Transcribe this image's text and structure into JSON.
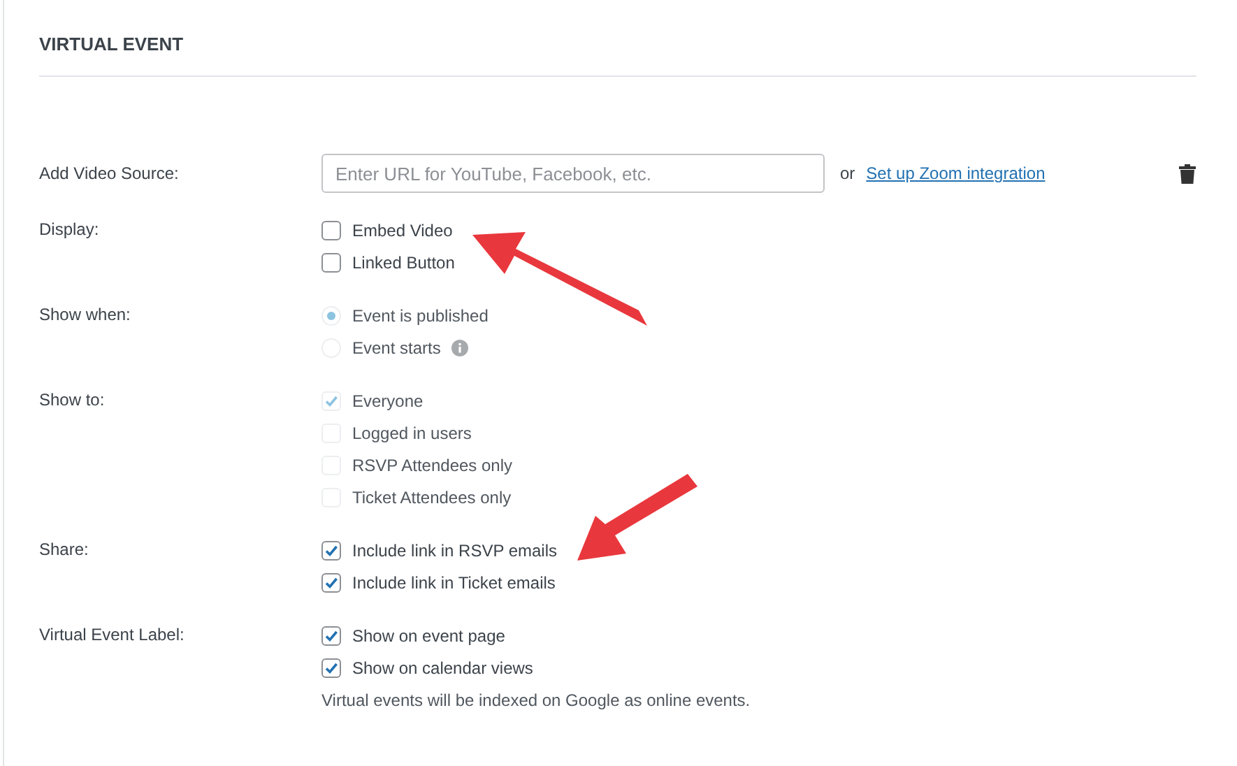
{
  "section": {
    "title": "VIRTUAL EVENT"
  },
  "video_source": {
    "label": "Add Video Source:",
    "placeholder": "Enter URL for YouTube, Facebook, etc.",
    "separator": "or",
    "link": "Set up Zoom integration"
  },
  "groups": [
    {
      "label": "Display:",
      "kind": "checkbox",
      "options": [
        {
          "label": "Embed Video",
          "checked": false,
          "disabled": false
        },
        {
          "label": "Linked Button",
          "checked": false,
          "disabled": false
        }
      ]
    },
    {
      "label": "Show when:",
      "kind": "radio",
      "options": [
        {
          "label": "Event is published",
          "selected": true,
          "disabled": true
        },
        {
          "label": "Event starts",
          "selected": false,
          "disabled": true,
          "info": true
        }
      ]
    },
    {
      "label": "Show to:",
      "kind": "checkbox",
      "options": [
        {
          "label": "Everyone",
          "checked": true,
          "disabled": true
        },
        {
          "label": "Logged in users",
          "checked": false,
          "disabled": true
        },
        {
          "label": "RSVP Attendees only",
          "checked": false,
          "disabled": true
        },
        {
          "label": "Ticket Attendees only",
          "checked": false,
          "disabled": true
        }
      ]
    },
    {
      "label": "Share:",
      "kind": "checkbox",
      "options": [
        {
          "label": "Include link in RSVP emails",
          "checked": true,
          "disabled": false
        },
        {
          "label": "Include link in Ticket emails",
          "checked": true,
          "disabled": false
        }
      ]
    },
    {
      "label": "Virtual Event Label:",
      "kind": "checkbox",
      "options": [
        {
          "label": "Show on event page",
          "checked": true,
          "disabled": false
        },
        {
          "label": "Show on calendar views",
          "checked": true,
          "disabled": false
        }
      ],
      "note": "Virtual events will be indexed on Google as online events."
    }
  ]
}
